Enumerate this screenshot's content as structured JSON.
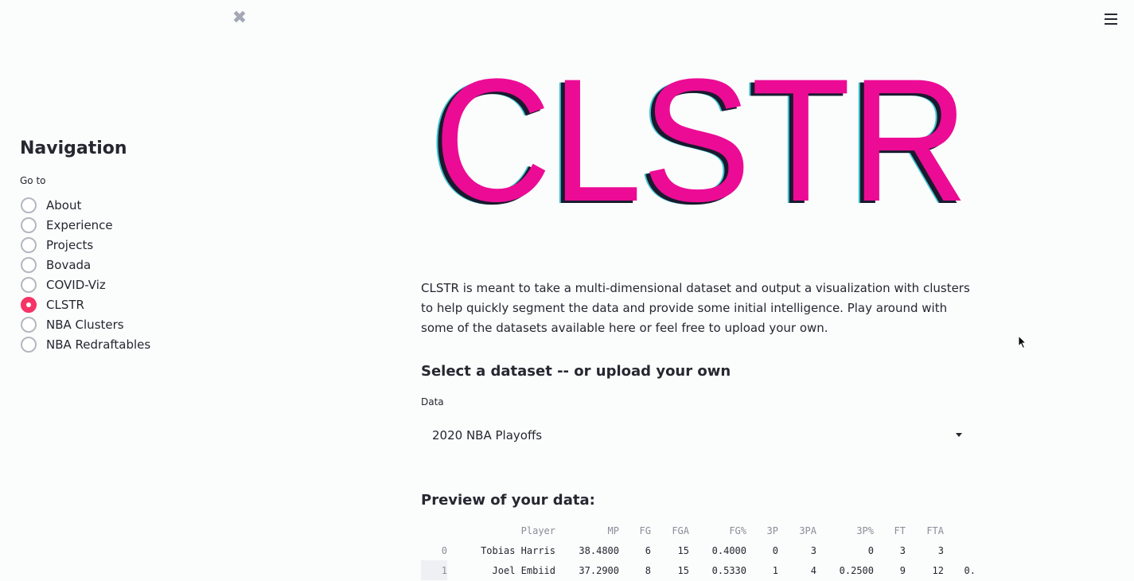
{
  "sidebar": {
    "close_glyph": "✖",
    "title": "Navigation",
    "go_to_label": "Go to",
    "options": [
      {
        "label": "About",
        "checked": false
      },
      {
        "label": "Experience",
        "checked": false
      },
      {
        "label": "Projects",
        "checked": false
      },
      {
        "label": "Bovada",
        "checked": false
      },
      {
        "label": "COVID-Viz",
        "checked": false
      },
      {
        "label": "CLSTR",
        "checked": true
      },
      {
        "label": "NBA Clusters",
        "checked": false
      },
      {
        "label": "NBA Redraftables",
        "checked": false
      }
    ]
  },
  "logo": {
    "text": "CLSTR",
    "fill_color": "#ec0b95",
    "shadow_color": "#40c5d1",
    "outline_color": "#1a1a2e"
  },
  "main": {
    "intro": "CLSTR is meant to take a multi-dimensional dataset and output a visualization with clusters to help quickly segment the data and provide some initial intelligence. Play around with some of the datasets available here or feel free to upload your own.",
    "select_title": "Select a dataset -- or upload your own",
    "data_label": "Data",
    "dataset_value": "2020 NBA Playoffs",
    "preview_title": "Preview of your data:"
  },
  "table": {
    "columns": [
      "",
      "Player",
      "MP",
      "FG",
      "FGA",
      "FG%",
      "3P",
      "3PA",
      "3P%",
      "FT",
      "FTA",
      ""
    ],
    "rows": [
      [
        "0",
        "Tobias Harris",
        "38.4800",
        "6",
        "15",
        "0.4000",
        "0",
        "3",
        "0",
        "3",
        "3",
        ""
      ],
      [
        "1",
        "Joel Embiid",
        "37.2900",
        "8",
        "15",
        "0.5330",
        "1",
        "4",
        "0.2500",
        "9",
        "12",
        "0."
      ]
    ]
  },
  "colors": {
    "accent": "#f63366",
    "text": "#262730",
    "background": "#fbfcfc"
  }
}
